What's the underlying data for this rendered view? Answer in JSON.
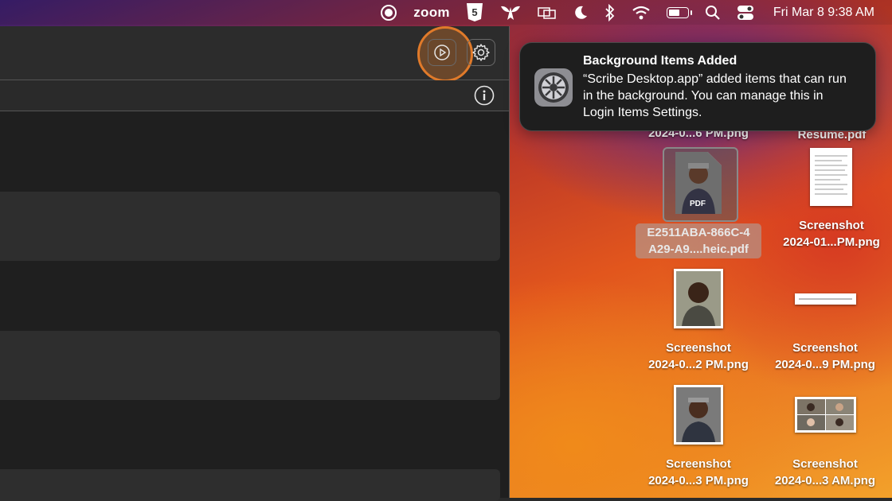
{
  "menubar": {
    "items": [
      {
        "name": "screen-record-icon"
      },
      {
        "name": "zoom-menu-item",
        "label": "zoom"
      },
      {
        "name": "html5-icon"
      },
      {
        "name": "bee-icon"
      },
      {
        "name": "display-mirroring-icon"
      },
      {
        "name": "moon-icon"
      },
      {
        "name": "bluetooth-icon"
      },
      {
        "name": "wifi-icon"
      },
      {
        "name": "battery-icon"
      },
      {
        "name": "spotlight-search-icon"
      },
      {
        "name": "control-center-icon"
      }
    ],
    "clock": "Fri Mar 8  9:38 AM"
  },
  "notification": {
    "title": "Background Items Added",
    "body": "“Scribe Desktop.app” added items that can run in the background. You can manage this in Login Items Settings.",
    "icon": "system-settings-gear-icon"
  },
  "desktop_files": [
    {
      "line1": "2024-0...6 PM.png",
      "line2": ""
    },
    {
      "line1": "Resume.pdf",
      "line2": ""
    },
    {
      "line1": "E2511ABA-866C-4",
      "line2": "A29-A9....heic.pdf"
    },
    {
      "line1": "Screenshot",
      "line2": "2024-01...PM.png"
    },
    {
      "line1": "Screenshot",
      "line2": "2024-0...2 PM.png"
    },
    {
      "line1": "Screenshot",
      "line2": "2024-0...9 PM.png"
    },
    {
      "line1": "Screenshot",
      "line2": "2024-0...3 PM.png"
    },
    {
      "line1": "Screenshot",
      "line2": "2024-0...3 AM.png"
    }
  ],
  "pdf_badge": "PDF",
  "colors": {
    "highlight": "#e07a2a",
    "window_bg": "#1f1f1f",
    "panel_bg": "#2e2e2e"
  }
}
